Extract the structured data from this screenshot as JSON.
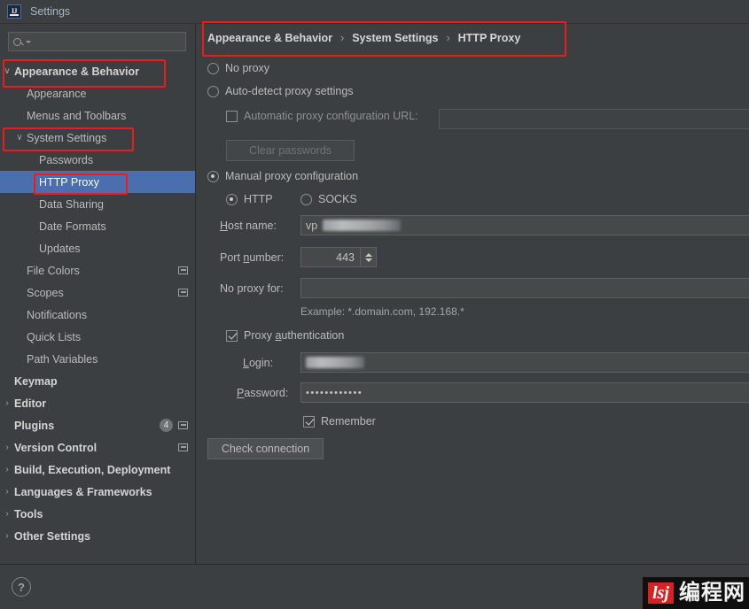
{
  "window": {
    "title": "Settings",
    "app_icon": "intellij-idea-icon"
  },
  "search": {
    "value": "",
    "placeholder": "",
    "icon": "search-icon"
  },
  "sidebar": {
    "items": [
      {
        "label": "Appearance & Behavior",
        "level": 0,
        "arrow": "∨",
        "bold": true,
        "selected": false,
        "badge": null,
        "config_icon": false
      },
      {
        "label": "Appearance",
        "level": 1,
        "arrow": "",
        "bold": false,
        "selected": false,
        "badge": null,
        "config_icon": false
      },
      {
        "label": "Menus and Toolbars",
        "level": 1,
        "arrow": "",
        "bold": false,
        "selected": false,
        "badge": null,
        "config_icon": false
      },
      {
        "label": "System Settings",
        "level": 1,
        "arrow": "∨",
        "bold": false,
        "selected": false,
        "badge": null,
        "config_icon": false
      },
      {
        "label": "Passwords",
        "level": 2,
        "arrow": "",
        "bold": false,
        "selected": false,
        "badge": null,
        "config_icon": false
      },
      {
        "label": "HTTP Proxy",
        "level": 2,
        "arrow": "",
        "bold": false,
        "selected": true,
        "badge": null,
        "config_icon": false
      },
      {
        "label": "Data Sharing",
        "level": 2,
        "arrow": "",
        "bold": false,
        "selected": false,
        "badge": null,
        "config_icon": false
      },
      {
        "label": "Date Formats",
        "level": 2,
        "arrow": "",
        "bold": false,
        "selected": false,
        "badge": null,
        "config_icon": false
      },
      {
        "label": "Updates",
        "level": 2,
        "arrow": "",
        "bold": false,
        "selected": false,
        "badge": null,
        "config_icon": false
      },
      {
        "label": "File Colors",
        "level": 1,
        "arrow": "",
        "bold": false,
        "selected": false,
        "badge": null,
        "config_icon": true
      },
      {
        "label": "Scopes",
        "level": 1,
        "arrow": "",
        "bold": false,
        "selected": false,
        "badge": null,
        "config_icon": true
      },
      {
        "label": "Notifications",
        "level": 1,
        "arrow": "",
        "bold": false,
        "selected": false,
        "badge": null,
        "config_icon": false
      },
      {
        "label": "Quick Lists",
        "level": 1,
        "arrow": "",
        "bold": false,
        "selected": false,
        "badge": null,
        "config_icon": false
      },
      {
        "label": "Path Variables",
        "level": 1,
        "arrow": "",
        "bold": false,
        "selected": false,
        "badge": null,
        "config_icon": false
      },
      {
        "label": "Keymap",
        "level": 0,
        "arrow": "",
        "bold": true,
        "selected": false,
        "badge": null,
        "config_icon": false
      },
      {
        "label": "Editor",
        "level": 0,
        "arrow": "›",
        "bold": true,
        "selected": false,
        "badge": null,
        "config_icon": false
      },
      {
        "label": "Plugins",
        "level": 0,
        "arrow": "",
        "bold": true,
        "selected": false,
        "badge": "4",
        "config_icon": true
      },
      {
        "label": "Version Control",
        "level": 0,
        "arrow": "›",
        "bold": true,
        "selected": false,
        "badge": null,
        "config_icon": true
      },
      {
        "label": "Build, Execution, Deployment",
        "level": 0,
        "arrow": "›",
        "bold": true,
        "selected": false,
        "badge": null,
        "config_icon": false
      },
      {
        "label": "Languages & Frameworks",
        "level": 0,
        "arrow": "›",
        "bold": true,
        "selected": false,
        "badge": null,
        "config_icon": false
      },
      {
        "label": "Tools",
        "level": 0,
        "arrow": "›",
        "bold": true,
        "selected": false,
        "badge": null,
        "config_icon": false
      },
      {
        "label": "Other Settings",
        "level": 0,
        "arrow": "›",
        "bold": true,
        "selected": false,
        "badge": null,
        "config_icon": false
      }
    ]
  },
  "breadcrumb": {
    "parts": [
      "Appearance & Behavior",
      "System Settings",
      "HTTP Proxy"
    ],
    "separator": "›"
  },
  "proxy": {
    "no_proxy": {
      "label": "No proxy",
      "selected": false
    },
    "auto_detect": {
      "label": "Auto-detect proxy settings",
      "selected": false
    },
    "auto_config_url": {
      "label": "Automatic proxy configuration URL:",
      "checked": false,
      "value": ""
    },
    "clear_passwords": {
      "label": "Clear passwords",
      "enabled": false
    },
    "manual": {
      "label": "Manual proxy configuration",
      "selected": true
    },
    "protocol_http": {
      "label": "HTTP",
      "selected": true
    },
    "protocol_socks": {
      "label": "SOCKS",
      "selected": false
    },
    "host_name": {
      "label": "Host name:",
      "value": "vp",
      "redacted": true
    },
    "port_number": {
      "label": "Port number:",
      "value": "443"
    },
    "no_proxy_for": {
      "label": "No proxy for:",
      "value": ""
    },
    "example_hint": "Example: *.domain.com, 192.168.*",
    "proxy_authentication": {
      "label": "Proxy authentication",
      "checked": true
    },
    "login": {
      "label": "Login:",
      "value": "",
      "redacted": true
    },
    "password": {
      "label": "Password:",
      "value": "••••••••••••"
    },
    "remember": {
      "label": "Remember",
      "checked": true
    },
    "check_connection": {
      "label": "Check connection"
    }
  },
  "help": {
    "icon": "question-mark-icon",
    "label": "?"
  },
  "watermark": {
    "logo": "lsj",
    "text": "编程网"
  },
  "colors": {
    "accent_selection": "#4b6eaf",
    "annotation_red": "#ee1b1b",
    "panel_bg": "#3c3f41",
    "field_bg": "#45494a",
    "text": "#bbbbbb"
  }
}
